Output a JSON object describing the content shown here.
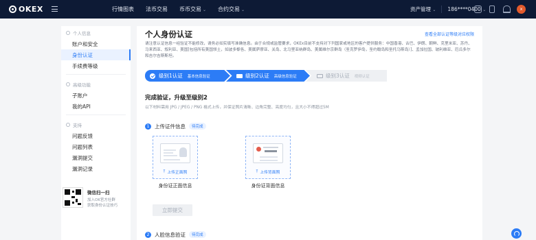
{
  "header": {
    "logo": "OKEX",
    "nav": [
      {
        "label": "行情图表",
        "has_caret": false
      },
      {
        "label": "法币交易",
        "has_caret": false
      },
      {
        "label": "币币交易",
        "has_caret": true
      },
      {
        "label": "合约交易",
        "has_caret": true
      }
    ],
    "asset_label": "资产管理",
    "phone": "186****0400",
    "avatar_text": "x",
    "caret": "⌄"
  },
  "sidebar": {
    "groups": [
      {
        "title": "个人信息",
        "items": [
          {
            "label": "账户和安全",
            "active": false
          },
          {
            "label": "身份认证",
            "active": true
          },
          {
            "label": "手续费等级",
            "active": false
          }
        ]
      },
      {
        "title": "高级功能",
        "items": [
          {
            "label": "子账户",
            "active": false
          },
          {
            "label": "我的API",
            "active": false
          }
        ]
      },
      {
        "title": "支持",
        "items": [
          {
            "label": "问题反馈",
            "active": false
          },
          {
            "label": "问题列表",
            "active": false
          },
          {
            "label": "漏洞提交",
            "active": false
          },
          {
            "label": "漏洞记录",
            "active": false
          }
        ]
      }
    ],
    "qr": {
      "title": "微信扫一扫",
      "line1": "加入OK官方社群",
      "line2": "获取身份认证技巧"
    }
  },
  "main": {
    "title": "个人身份认证",
    "top_link": "查看全部认证等级对应权限",
    "notice": "请注意认证信息一经验证不能修改，请务必如实填写准确信息。由于合规或监管要求，OKEx目前不支持对下列国家或地区的客户提供服务：中国香港、古巴、伊朗、朝鲜、克里米亚、苏丹、马来西亚、叙利亚、美国[包括所有美国领土，如波多黎各、美属萨摩亚、关岛、北马里亚纳群岛、美属维尔京群岛（圣克罗伊岛，圣约翰岛和圣托马斯岛）]、孟加拉国、玻利维亚、厄瓜多尔和吉尔吉斯斯坦。",
    "steps": [
      {
        "label": "级别1认证",
        "sub": "基本信息验证",
        "state": "done"
      },
      {
        "label": "级别2认证",
        "sub": "高级信息验证",
        "state": "current"
      },
      {
        "label": "级别3认证",
        "sub": "视频认证",
        "state": "pending"
      }
    ],
    "section_title": "完成验证，升级至级别2",
    "section_sub": "以下材料需用 JPG / JPEG / PNG 格式上传，并保证照片清晰、边角完整、亮度均匀，且大小不得超过5M",
    "sub1": {
      "num": "1",
      "label": "上传证件信息",
      "badge": "待完成"
    },
    "uploads": [
      {
        "label": "上传正面照",
        "caption": "身份证正面信息"
      },
      {
        "label": "上传背面照",
        "caption": "身份证背面信息"
      }
    ],
    "submit_label": "立即提交",
    "sub2": {
      "num": "2",
      "label": "人脸信息验证",
      "badge": "待完成"
    }
  },
  "colors": {
    "topbar": "#0d1a35",
    "accent": "#2c7cf6",
    "page_bg": "#f4f5f7"
  }
}
